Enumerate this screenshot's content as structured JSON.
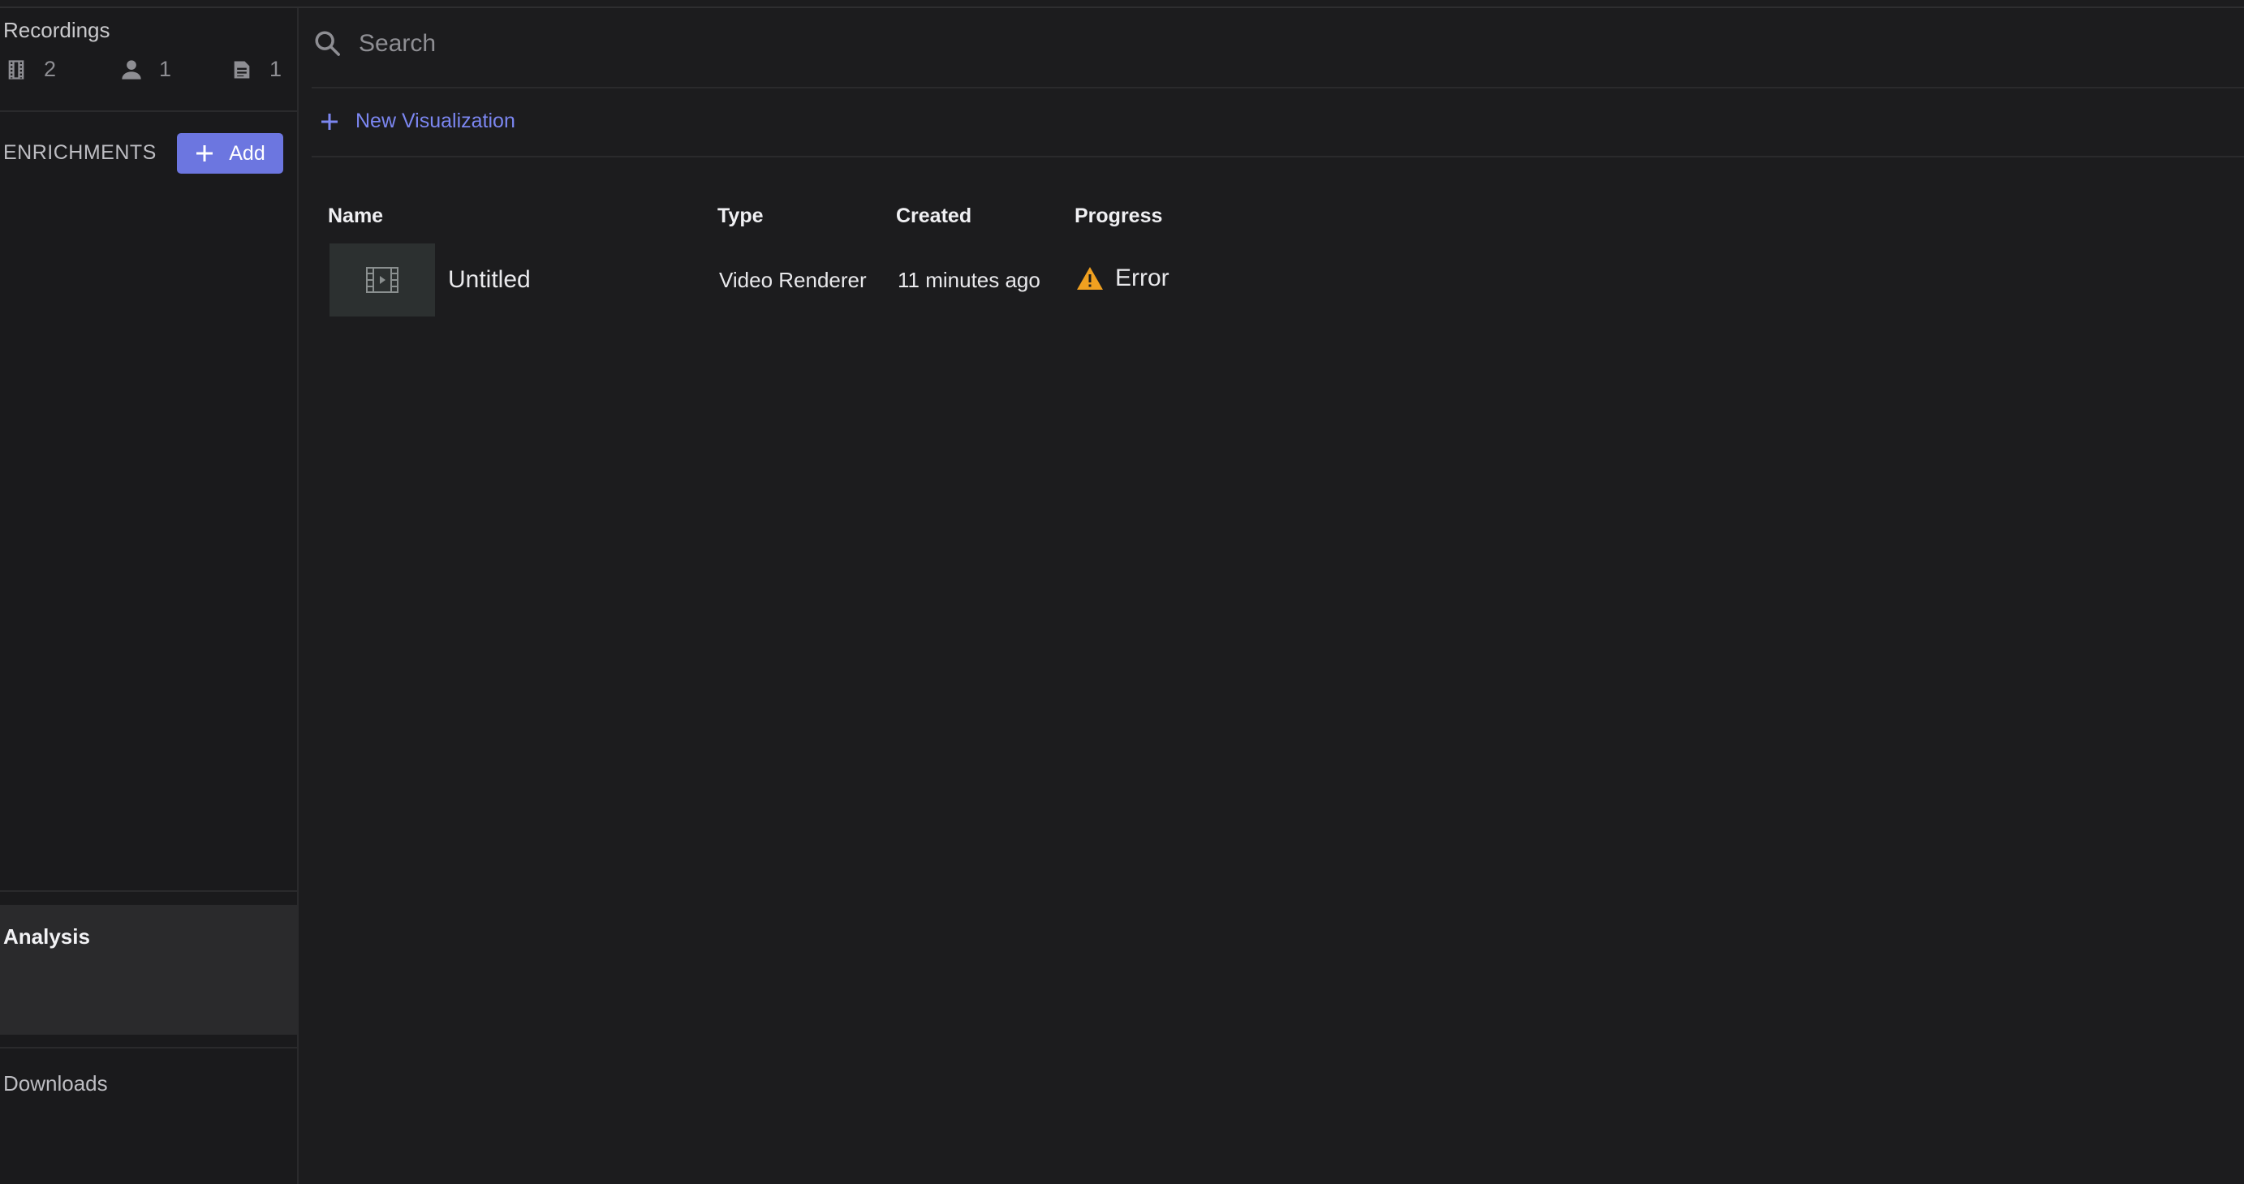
{
  "sidebar": {
    "recordings_title": "Recordings",
    "stats": [
      {
        "icon": "film-icon",
        "value": "2"
      },
      {
        "icon": "person-icon",
        "value": "1"
      },
      {
        "icon": "document-icon",
        "value": "1"
      }
    ],
    "enrichments_label": "ENRICHMENTS",
    "add_button_label": "Add",
    "analysis_label": "Analysis",
    "downloads_label": "Downloads"
  },
  "search": {
    "placeholder": "Search"
  },
  "toolbar": {
    "new_visualization_label": "New Visualization"
  },
  "table": {
    "columns": [
      "Name",
      "Type",
      "Created",
      "Progress"
    ],
    "rows": [
      {
        "name": "Untitled",
        "type": "Video Renderer",
        "created": "11 minutes ago",
        "progress": "Error"
      }
    ]
  },
  "colors": {
    "accent": "#6c76e0",
    "link": "#7b86f0",
    "warning": "#f0a020",
    "background": "#1c1c1e"
  }
}
